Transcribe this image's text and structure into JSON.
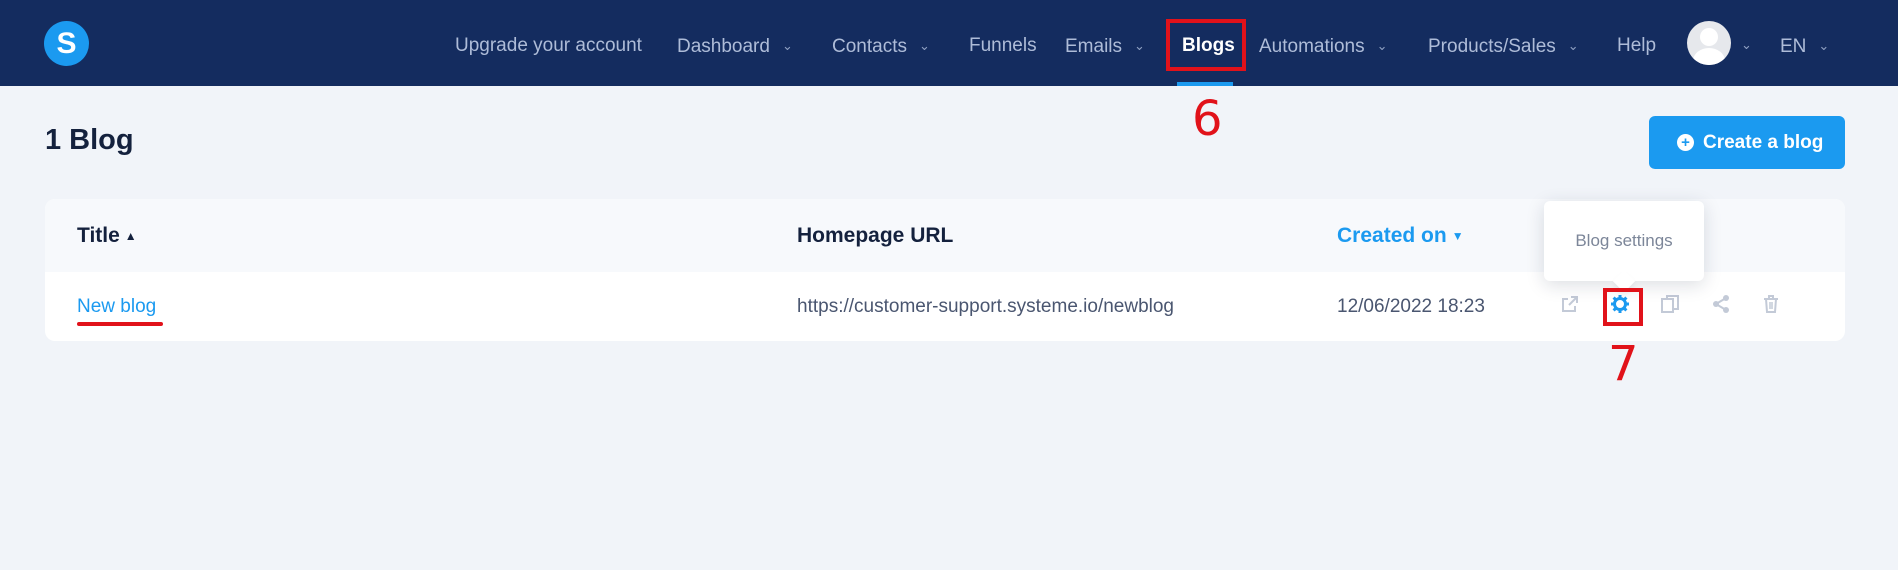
{
  "brand": {
    "logo_letter": "S"
  },
  "nav": {
    "upgrade": "Upgrade your account",
    "dashboard": "Dashboard",
    "contacts": "Contacts",
    "funnels": "Funnels",
    "emails": "Emails",
    "blogs": "Blogs",
    "automations": "Automations",
    "products_sales": "Products/Sales",
    "help": "Help",
    "language": "EN",
    "active_item": "Blogs"
  },
  "annotations": {
    "step_blogs": "6",
    "step_settings": "7"
  },
  "page": {
    "title": "1 Blog",
    "create_button": "Create a blog"
  },
  "table": {
    "columns": {
      "title": "Title",
      "homepage_url": "Homepage URL",
      "created_on": "Created on"
    },
    "rows": [
      {
        "title": "New blog",
        "homepage_url": "https://customer-support.systeme.io/newblog",
        "created_on": "12/06/2022 18:23"
      }
    ]
  },
  "tooltip": {
    "text": "Blog settings"
  },
  "colors": {
    "nav_bg": "#142c5f",
    "accent": "#1b9af0",
    "annotation": "#e1121a",
    "page_bg": "#f1f4f9"
  },
  "icons": {
    "row_actions": [
      "external-link-icon",
      "gear-icon",
      "copy-icon",
      "share-icon",
      "trash-icon"
    ]
  }
}
